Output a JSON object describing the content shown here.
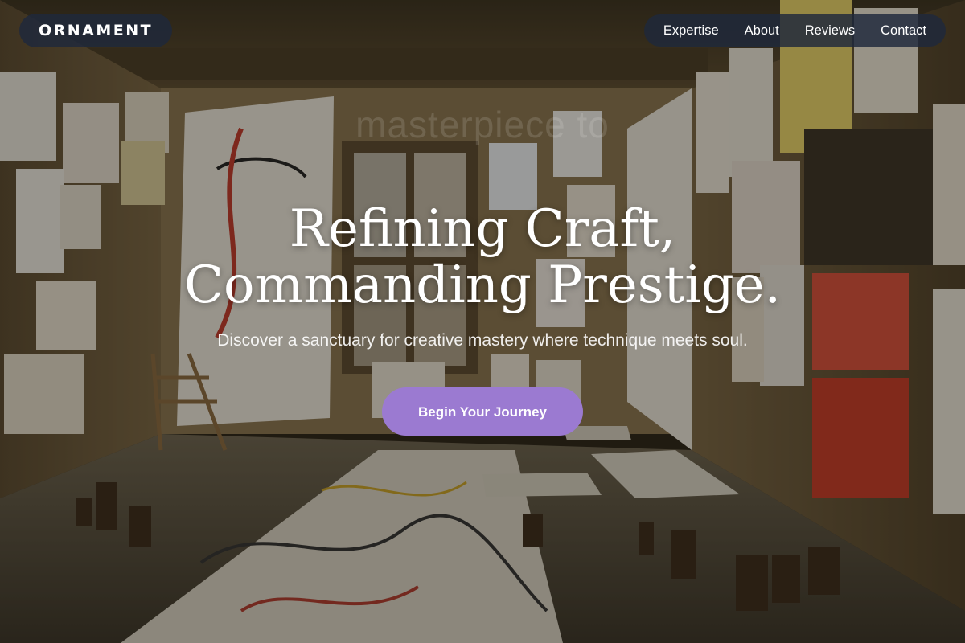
{
  "brand": {
    "name": "ORNAMENT"
  },
  "nav": {
    "items": [
      {
        "label": "Expertise"
      },
      {
        "label": "About"
      },
      {
        "label": "Reviews"
      },
      {
        "label": "Contact"
      }
    ]
  },
  "hero": {
    "headline_line1": "Refining Craft,",
    "headline_line2": "Commanding Prestige.",
    "ghost_text": "masterpiece to",
    "subtitle": "Discover a sanctuary for creative mastery where technique meets soul.",
    "cta_label": "Begin Your Journey"
  },
  "colors": {
    "nav_pill": "#1e283c",
    "cta": "#9b7ad1",
    "text": "#ffffff"
  }
}
